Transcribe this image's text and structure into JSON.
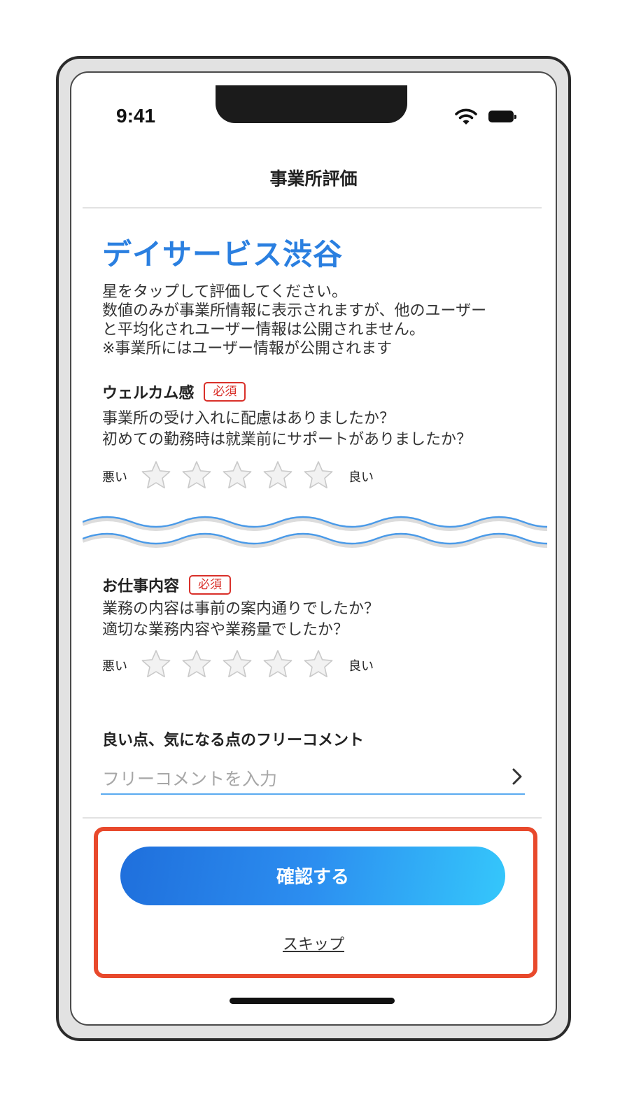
{
  "status_bar": {
    "time": "9:41"
  },
  "nav": {
    "title": "事業所評価"
  },
  "facility": {
    "name": "デイサービス渋谷"
  },
  "instructions": [
    "星をタップして評価してください。",
    "数値のみが事業所情報に表示されますが、他のユーザー",
    "と平均化されユーザー情報は公開されません。",
    "※事業所にはユーザー情報が公開されます"
  ],
  "sections": [
    {
      "title": "ウェルカム感",
      "badge": "必須",
      "questions": [
        "事業所の受け入れに配慮はありましたか？",
        "初めての勤務時は就業前にサポートがありましたか？"
      ],
      "rating": {
        "low_label": "悪い",
        "high_label": "良い",
        "value": 0,
        "max": 5
      }
    },
    {
      "title": "お仕事内容",
      "badge": "必須",
      "questions": [
        "業務の内容は事前の案内通りでしたか？",
        "適切な業務内容や業務量でしたか？"
      ],
      "rating": {
        "low_label": "悪い",
        "high_label": "良い",
        "value": 0,
        "max": 5
      }
    }
  ],
  "comment": {
    "title": "良い点、気になる点のフリーコメント",
    "placeholder": "フリーコメントを入力"
  },
  "actions": {
    "confirm_label": "確認する",
    "skip_label": "スキップ"
  },
  "colors": {
    "accent": "#2a7fe0",
    "required": "#d9302a",
    "highlight": "#e8492c",
    "star_fill": "#f2f2f2",
    "star_stroke": "#c9c9c9"
  },
  "icons": [
    "wifi-icon",
    "battery-icon",
    "star-icon",
    "chevron-right-icon"
  ]
}
